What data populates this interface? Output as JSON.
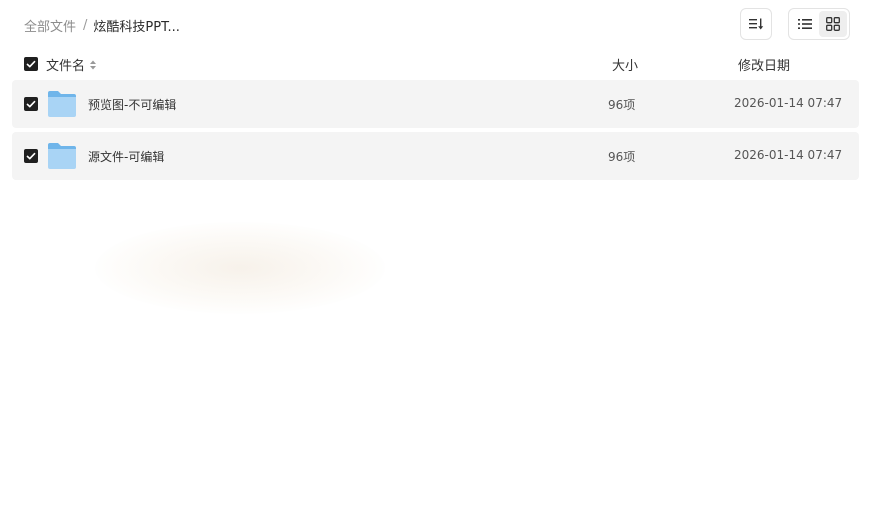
{
  "breadcrumb": {
    "root": "全部文件",
    "separator": "/",
    "current": "炫酷科技PPT..."
  },
  "toolbar": {
    "sort_icon": "sort-list-icon",
    "view_list_icon": "list-view-icon",
    "view_grid_icon": "grid-view-icon"
  },
  "table": {
    "headers": {
      "name": "文件名",
      "size": "大小",
      "date": "修改日期"
    },
    "rows": [
      {
        "name": "预览图-不可编辑",
        "size": "96项",
        "date": "2026-01-14 07:47",
        "checked": true,
        "icon": "folder-icon"
      },
      {
        "name": "源文件-可编辑",
        "size": "96项",
        "date": "2026-01-14 07:47",
        "checked": true,
        "icon": "folder-icon"
      }
    ]
  },
  "colors": {
    "row_bg": "#f4f4f4",
    "checkbox": "#1f1f1f",
    "folder_light": "#a9d4f5",
    "folder_dark": "#6fb5ea"
  }
}
